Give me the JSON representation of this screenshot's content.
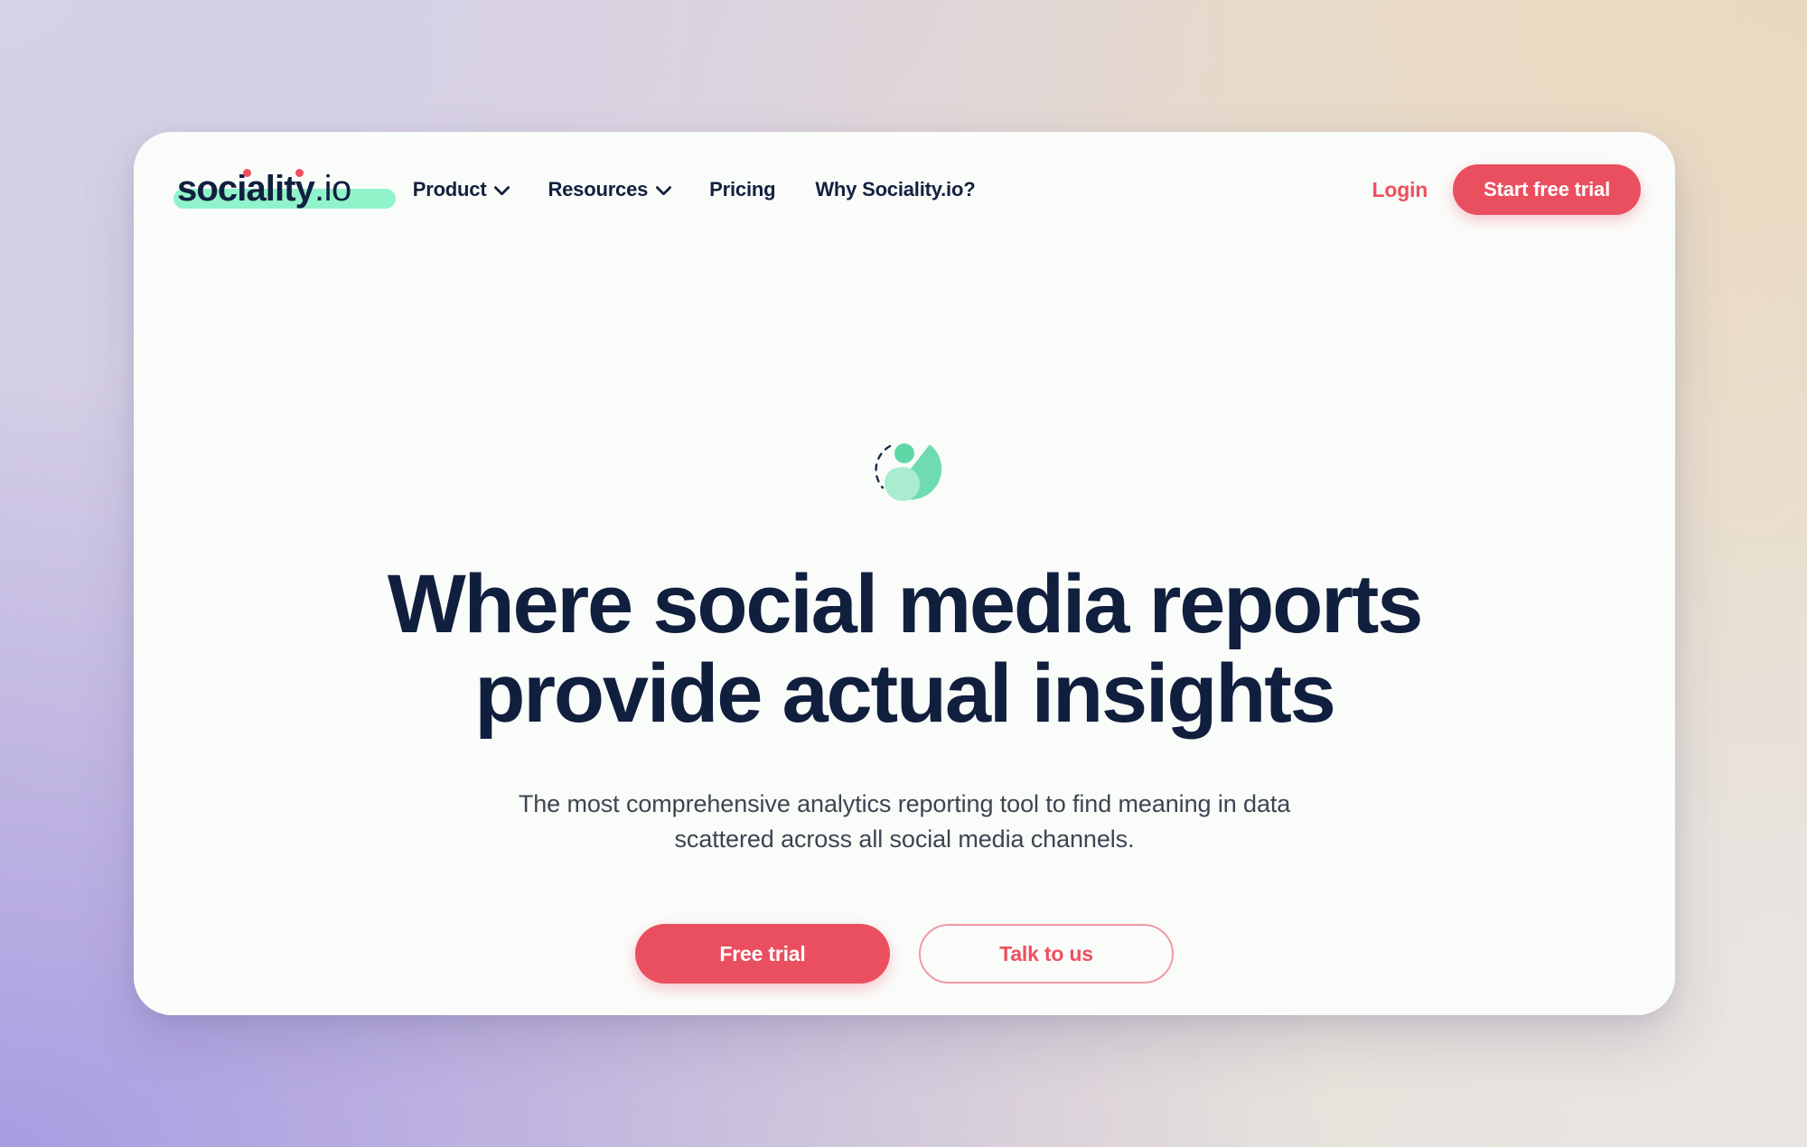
{
  "brand": {
    "logo_text": "sociality",
    "logo_suffix": ".io",
    "accent_red": "#ea4f60",
    "accent_mint": "#7df1c0",
    "ink": "#111f3e"
  },
  "header": {
    "nav": [
      {
        "label": "Product",
        "has_dropdown": true
      },
      {
        "label": "Resources",
        "has_dropdown": true
      },
      {
        "label": "Pricing",
        "has_dropdown": false
      },
      {
        "label": "Why Sociality.io?",
        "has_dropdown": false
      }
    ],
    "login_label": "Login",
    "cta_label": "Start free trial"
  },
  "hero": {
    "mark_icon": "sociality-glyph-icon",
    "title_line1": "Where social media reports",
    "title_line2": "provide actual insights",
    "subtitle_line1": "The most comprehensive analytics reporting tool to find meaning in data",
    "subtitle_line2": "scattered across all social media channels.",
    "primary_cta": "Free trial",
    "secondary_cta": "Talk to us"
  }
}
